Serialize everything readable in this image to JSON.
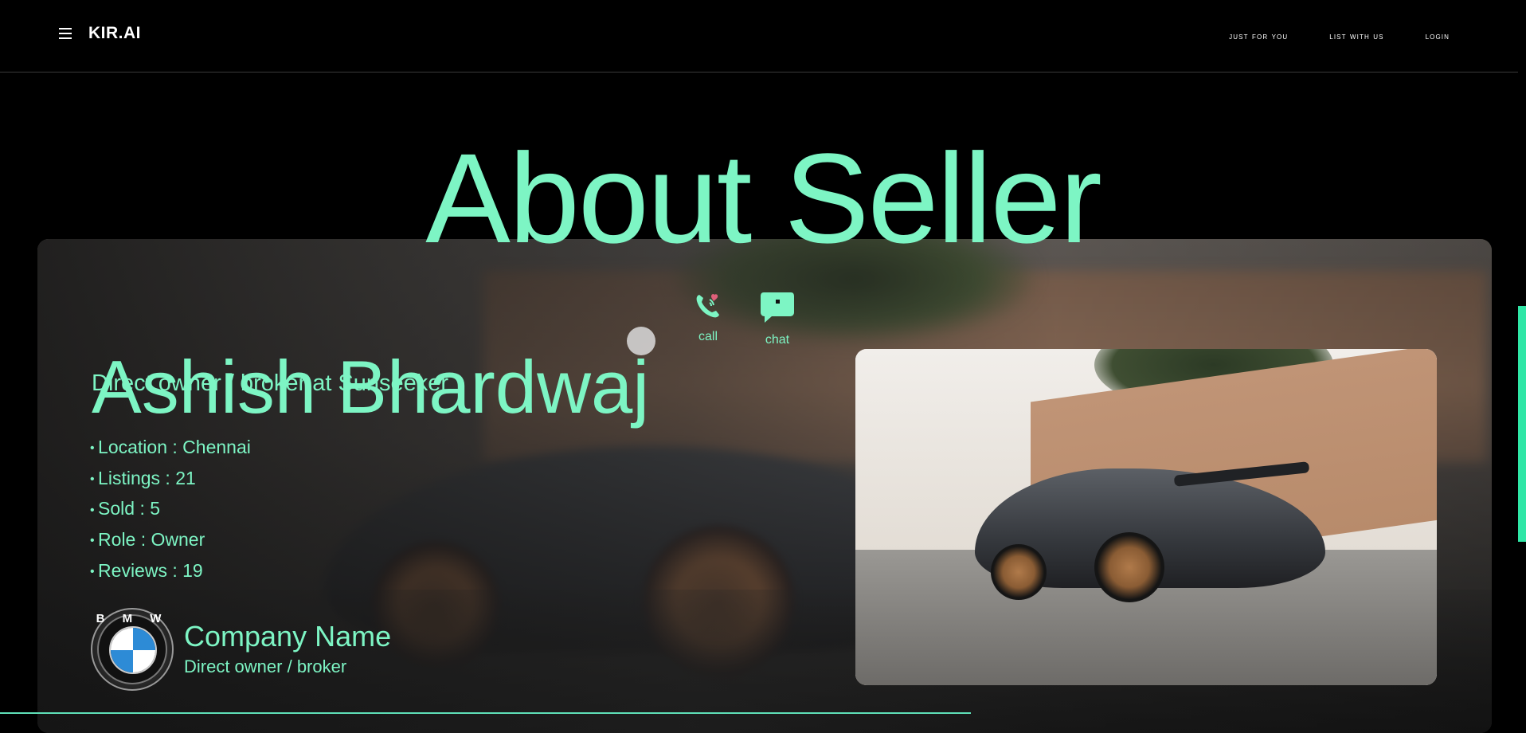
{
  "header": {
    "brand": "KIR.AI",
    "nav": [
      "JUST FOR YOU",
      "LIST WITH US",
      "LOGIN"
    ]
  },
  "page": {
    "headline": "About Seller"
  },
  "seller": {
    "name": "Ashish Bhardwaj",
    "subtitle": "Direct owner / broker at Sunseeker",
    "actions": {
      "call": "call",
      "chat": "chat"
    },
    "details": [
      "Location : Chennai",
      "Listings : 21",
      "Sold : 5",
      "Role : Owner",
      "Reviews : 19"
    ]
  },
  "company": {
    "logo_letters": "B M W",
    "name": "Company Name",
    "role": "Direct owner / broker"
  },
  "icons": [
    "menu-icon",
    "phone-call-icon",
    "chat-bubble-icon"
  ],
  "colors": {
    "accent": "#7df5c4",
    "background": "#000000",
    "scroll_thumb": "#2fe6a6"
  },
  "progress": {
    "value_percent": 63.6
  }
}
